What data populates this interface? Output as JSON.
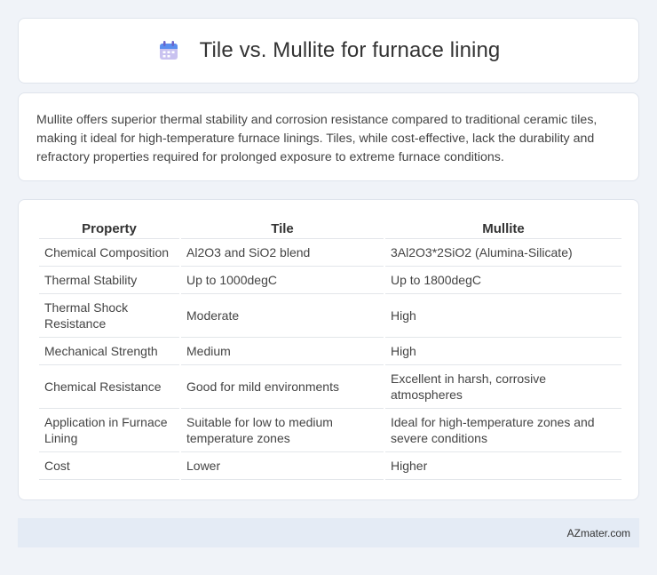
{
  "header": {
    "title": "Tile vs. Mullite for furnace lining",
    "icon": "calendar-icon"
  },
  "summary": {
    "text": "Mullite offers superior thermal stability and corrosion resistance compared to traditional ceramic tiles, making it ideal for high-temperature furnace linings. Tiles, while cost-effective, lack the durability and refractory properties required for prolonged exposure to extreme furnace conditions."
  },
  "table": {
    "headers": [
      "Property",
      "Tile",
      "Mullite"
    ],
    "rows": [
      [
        "Chemical Composition",
        "Al2O3 and SiO2 blend",
        "3Al2O3*2SiO2 (Alumina-Silicate)"
      ],
      [
        "Thermal Stability",
        "Up to 1000degC",
        "Up to 1800degC"
      ],
      [
        "Thermal Shock Resistance",
        "Moderate",
        "High"
      ],
      [
        "Mechanical Strength",
        "Medium",
        "High"
      ],
      [
        "Chemical Resistance",
        "Good for mild environments",
        "Excellent in harsh, corrosive atmospheres"
      ],
      [
        "Application in Furnace Lining",
        "Suitable for low to medium temperature zones",
        "Ideal for high-temperature zones and severe conditions"
      ],
      [
        "Cost",
        "Lower",
        "Higher"
      ]
    ]
  },
  "footer": {
    "brand": "AZmater.com"
  },
  "colors": {
    "background": "#f0f3f8",
    "card": "#ffffff",
    "footer": "#e4ebf5",
    "icon_blue": "#5b8def",
    "icon_purple": "#8e7cc3"
  }
}
